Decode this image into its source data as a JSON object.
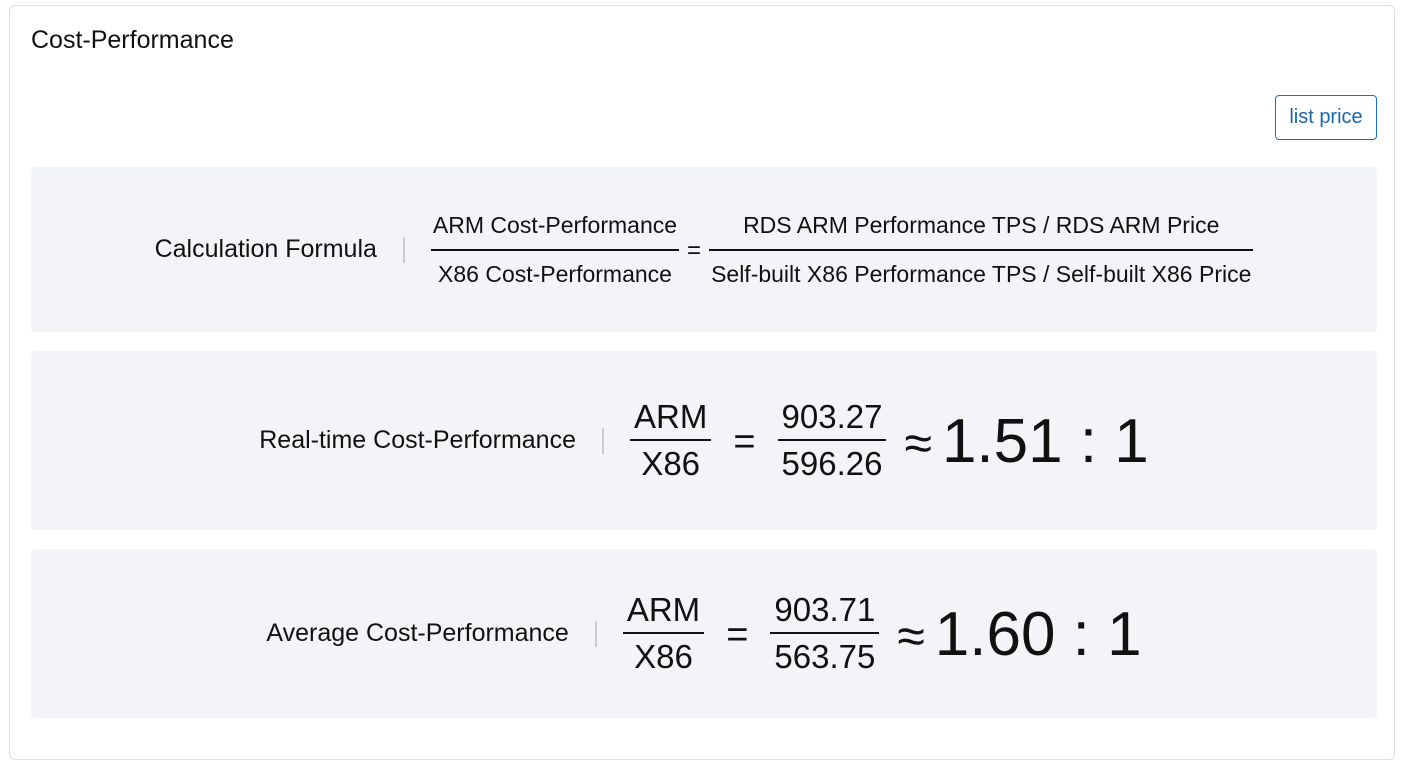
{
  "card": {
    "title": "Cost-Performance"
  },
  "toolbar": {
    "list_price_label": "list price"
  },
  "formula": {
    "label": "Calculation Formula",
    "left_numerator": "ARM Cost-Performance",
    "left_denominator": "X86 Cost-Performance",
    "equals": "=",
    "right_numerator": "RDS ARM Performance TPS / RDS ARM Price",
    "right_denominator": "Self-built X86 Performance TPS / Self-built X86 Price"
  },
  "realtime": {
    "label": "Real-time Cost-Performance",
    "numerator_label": "ARM",
    "denominator_label": "X86",
    "equals": "=",
    "arm_value": "903.27",
    "x86_value": "596.26",
    "approx": "≈",
    "ratio": "1.51 : 1"
  },
  "average": {
    "label": "Average Cost-Performance",
    "numerator_label": "ARM",
    "denominator_label": "X86",
    "equals": "=",
    "arm_value": "903.71",
    "x86_value": "563.75",
    "approx": "≈",
    "ratio": "1.60 : 1"
  },
  "colors": {
    "button_border": "#1f6fb2",
    "button_text": "#1b66a6",
    "panel_background": "#f3f4f7",
    "separator": "#c8cbd0"
  }
}
